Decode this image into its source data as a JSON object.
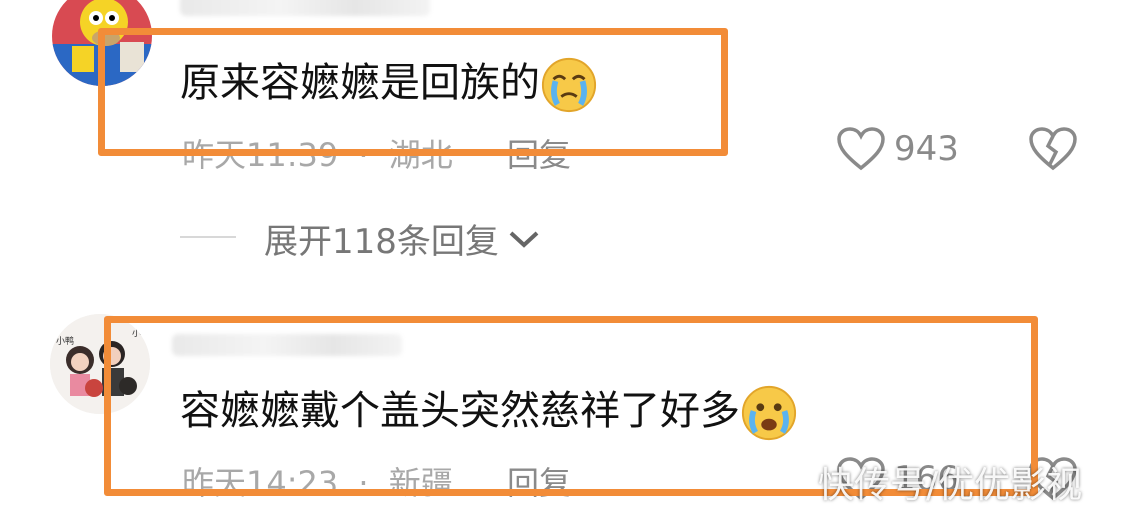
{
  "comments": [
    {
      "text": "原来容嬷嬷是回族的",
      "emoji_icon": "crying-face-emoji",
      "time": "昨天11:39",
      "sep": "·",
      "location": "湖北",
      "reply_label": "回复",
      "likes": "943"
    },
    {
      "text": "容嬷嬷戴个盖头突然慈祥了好多",
      "emoji_icon": "crying-face-emoji",
      "time": "昨天14:23",
      "sep": "·",
      "location": "新疆",
      "reply_label": "回复",
      "likes": "166"
    }
  ],
  "expand_replies": "展开118条回复",
  "watermark": "快传号/优优影视",
  "colors": {
    "highlight": "#f28c38",
    "meta": "#a8a8a8",
    "text": "#111111"
  }
}
